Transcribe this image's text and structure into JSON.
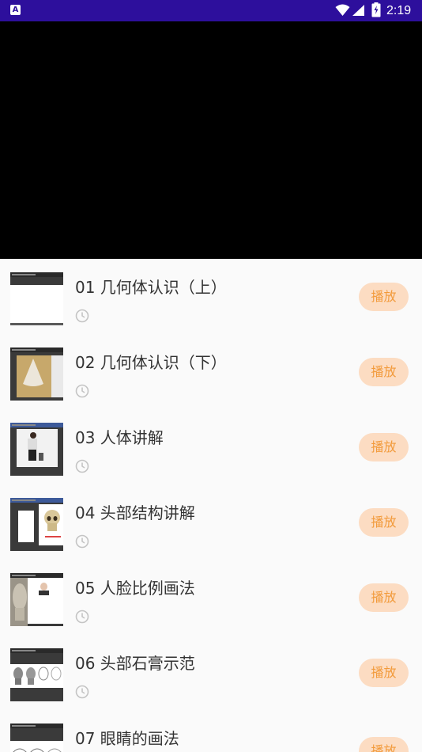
{
  "status_bar": {
    "app_icon_letter": "A",
    "time": "2:19"
  },
  "lessons": [
    {
      "title": "01 几何体认识（上）",
      "play_label": "播放"
    },
    {
      "title": "02 几何体认识（下）",
      "play_label": "播放"
    },
    {
      "title": "03 人体讲解",
      "play_label": "播放"
    },
    {
      "title": "04 头部结构讲解",
      "play_label": "播放"
    },
    {
      "title": "05 人脸比例画法",
      "play_label": "播放"
    },
    {
      "title": "06 头部石膏示范",
      "play_label": "播放"
    },
    {
      "title": "07 眼睛的画法",
      "play_label": "播放"
    }
  ],
  "colors": {
    "status_bar": "#2d0f9c",
    "play_button_bg": "#fcdcc2",
    "play_button_text": "#f29a3a"
  }
}
